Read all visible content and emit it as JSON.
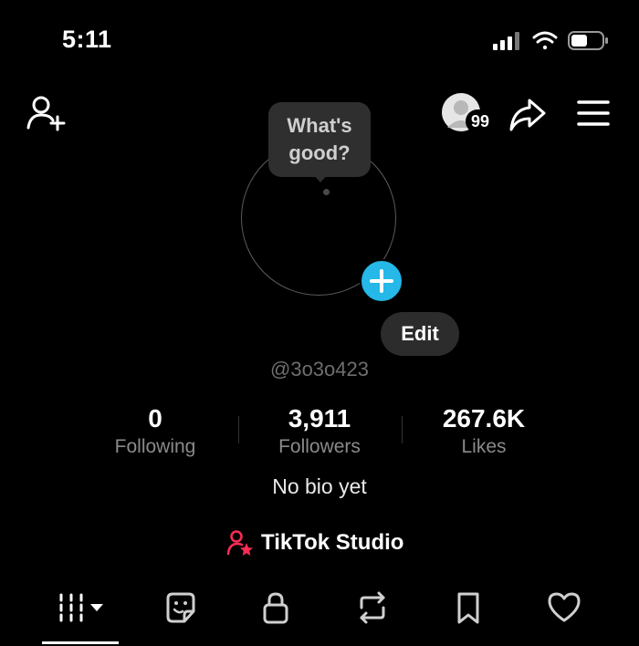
{
  "status_bar": {
    "time": "5:11",
    "icons": [
      "cellular-signal-icon",
      "wifi-icon",
      "battery-icon"
    ]
  },
  "header": {
    "add_friend_icon": "person-plus-icon",
    "notifications_avatar": {
      "badge": "99"
    },
    "share_icon": "share-arrow-icon",
    "menu_icon": "hamburger-menu-icon"
  },
  "profile": {
    "note_prompt": "What's good?",
    "add_photo_icon": "plus-icon",
    "edit_label": "Edit",
    "username": "@3o3o423",
    "bio": "No bio yet"
  },
  "stats": [
    {
      "value": "0",
      "label": "Following"
    },
    {
      "value": "3,911",
      "label": "Followers"
    },
    {
      "value": "267.6K",
      "label": "Likes"
    }
  ],
  "studio": {
    "label": "TikTok Studio",
    "icon": "person-star-icon",
    "accent": "#fe2c55"
  },
  "tabs": [
    {
      "icon": "grid-dropdown-icon",
      "active": true
    },
    {
      "icon": "sticker-icon"
    },
    {
      "icon": "lock-icon"
    },
    {
      "icon": "repost-icon"
    },
    {
      "icon": "bookmark-icon"
    },
    {
      "icon": "heart-icon"
    }
  ],
  "colors": {
    "background": "#000000",
    "accent_blue": "#25b8e8",
    "muted_text": "#8a8a8a"
  }
}
